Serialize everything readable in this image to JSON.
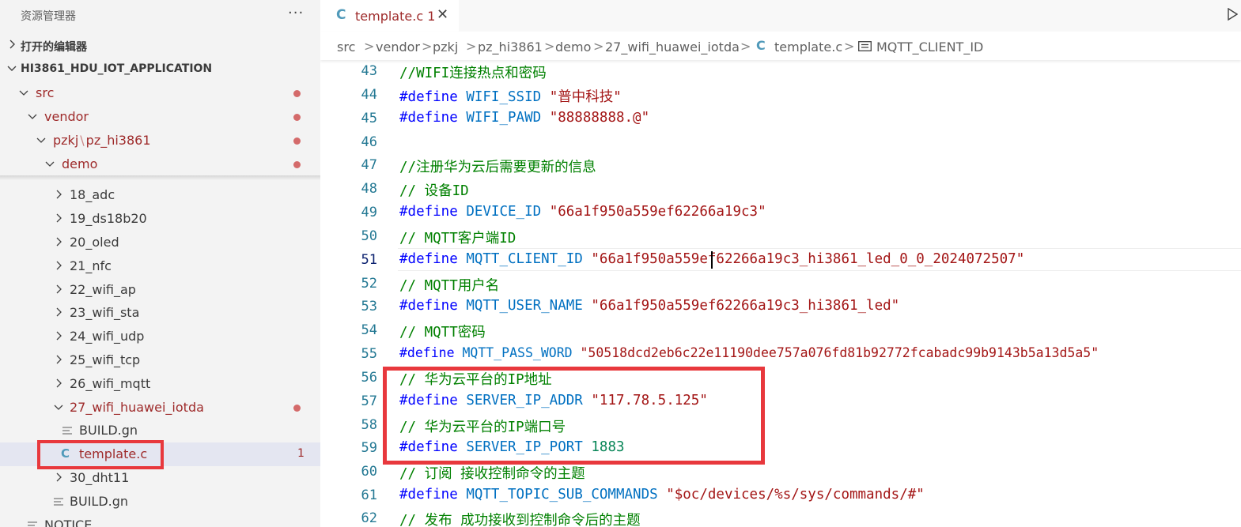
{
  "sidebar": {
    "title": "资源管理器",
    "more": "···",
    "open_editors": "打开的编辑器",
    "project": "HI3861_HDU_IOT_APPLICATION",
    "tree": {
      "src": "src",
      "vendor": "vendor",
      "pzkj": "pzkj",
      "pzkj_sep": "\\",
      "pz_hi3861": "pz_hi3861",
      "demo": "demo",
      "items": [
        "18_adc",
        "19_ds18b20",
        "20_oled",
        "21_nfc",
        "22_wifi_ap",
        "23_wifi_sta",
        "24_wifi_udp",
        "25_wifi_tcp",
        "26_wifi_mqtt"
      ],
      "iotda": "27_wifi_huawei_iotda",
      "build1": "BUILD.gn",
      "template": "template.c",
      "template_count": "1",
      "dht11": "30_dht11",
      "build2": "BUILD.gn",
      "notice": "NOTICE"
    }
  },
  "tab": {
    "icon": "C",
    "name": "template.c 1",
    "close": "✕"
  },
  "breadcrumb": {
    "items": [
      "src",
      "vendor",
      "pzkj",
      "pz_hi3861",
      "demo",
      "27_wifi_huawei_iotda",
      "template.c",
      "MQTT_CLIENT_ID"
    ],
    "sep": ">",
    "c_icon": "C"
  },
  "code": {
    "l43": {
      "n": "43",
      "cm": "//WIFI连接热点和密码"
    },
    "l44": {
      "n": "44",
      "kw": "#define",
      "id": "WIFI_SSID",
      "st": "\"普中科技\""
    },
    "l45": {
      "n": "45",
      "kw": "#define",
      "id": "WIFI_PAWD",
      "st": "\"88888888.@\""
    },
    "l46": {
      "n": "46"
    },
    "l47": {
      "n": "47",
      "cm": "//注册华为云后需要更新的信息"
    },
    "l48": {
      "n": "48",
      "cm": "// 设备ID"
    },
    "l49": {
      "n": "49",
      "kw": "#define",
      "id": "DEVICE_ID",
      "st": "\"66a1f950a559ef62266a19c3\""
    },
    "l50": {
      "n": "50",
      "cm": "// MQTT客户端ID"
    },
    "l51": {
      "n": "51",
      "kw": "#define",
      "id": "MQTT_CLIENT_ID",
      "st": "\"66a1f950a559ef62266a19c3_hi3861_led_0_0_2024072507\""
    },
    "l52": {
      "n": "52",
      "cm": "// MQTT用户名"
    },
    "l53": {
      "n": "53",
      "kw": "#define",
      "id": "MQTT_USER_NAME",
      "st": "\"66a1f950a559ef62266a19c3_hi3861_led\""
    },
    "l54": {
      "n": "54",
      "cm": "// MQTT密码"
    },
    "l55": {
      "n": "55",
      "kw": "#define",
      "id": "MQTT_PASS_WORD",
      "st": "\"50518dcd2eb6c22e11190dee757a076fd81b92772fcabadc99b9143b5a13d5a5\""
    },
    "l56": {
      "n": "56",
      "cm": "// 华为云平台的IP地址"
    },
    "l57": {
      "n": "57",
      "kw": "#define",
      "id": "SERVER_IP_ADDR",
      "st": "\"117.78.5.125\""
    },
    "l58": {
      "n": "58",
      "cm": "// 华为云平台的IP端口号"
    },
    "l59": {
      "n": "59",
      "kw": "#define",
      "id": "SERVER_IP_PORT",
      "nm": "1883"
    },
    "l60": {
      "n": "60",
      "cm": "// 订阅 接收控制命令的主题"
    },
    "l61": {
      "n": "61",
      "kw": "#define",
      "id": "MQTT_TOPIC_SUB_COMMANDS",
      "st": "\"$oc/devices/%s/sys/commands/#\""
    },
    "l62": {
      "n": "62",
      "cm": "// 发布 成功接收到控制命令后的主题"
    }
  },
  "colors": {
    "comment": "#008000",
    "keyword": "#0000ff",
    "identifier": "#0070c1",
    "string": "#a31515",
    "number": "#098658",
    "highlight_box": "#e8383d",
    "modified": "#9e2a2a"
  }
}
